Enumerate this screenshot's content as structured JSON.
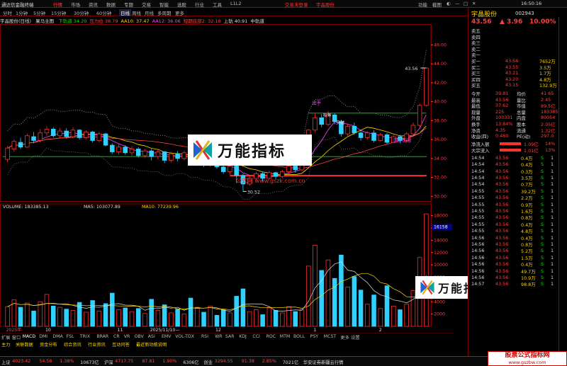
{
  "app": {
    "name": "通达信金融终端",
    "login_text": "交易未登录",
    "stock_tab": "宇晶股份",
    "win_controls": [
      "功能",
      "截图",
      "◐",
      "—",
      "□",
      "✕"
    ],
    "clock": "16:50:16"
  },
  "menu": [
    "行情",
    "市场",
    "资讯",
    "数据",
    "专题",
    "交易",
    "智能",
    "选股",
    "行业",
    "工具",
    "L1L2"
  ],
  "toolbar": [
    "分时",
    "1分钟",
    "5分钟",
    "15分钟",
    "30分钟",
    "60分钟",
    "日线",
    "周线",
    "月线",
    "多周期",
    "更多"
  ],
  "indicators": {
    "name": "宇晶股份(日线)",
    "mode": "果马主图",
    "items": [
      {
        "label": "下轨道",
        "value": "34.20",
        "color": "#00e000"
      },
      {
        "label": "压力位",
        "value": "38.79",
        "color": "#ff4040"
      },
      {
        "label": "AA10:",
        "value": "37.47",
        "color": "#ffd800"
      },
      {
        "label": "AA12:",
        "value": "36.06",
        "color": "#ff40ff"
      },
      {
        "label": "短期底部2:",
        "value": "32.18",
        "color": "#ff4040"
      },
      {
        "label": "上轨",
        "value": "40.91",
        "color": "#ddd"
      },
      {
        "label": "中轨道",
        "value": "",
        "color": "#ddd"
      }
    ]
  },
  "chart_data": {
    "type": "candlestick",
    "price_ticks": [
      "46.00",
      "44.00",
      "42.00",
      "40.00",
      "38.00",
      "36.00",
      "34.00",
      "32.00",
      "30.00"
    ],
    "price_range": [
      29.5,
      48.2
    ],
    "annotations": {
      "high": "43.56",
      "low": "30.52",
      "buy": "出手",
      "tag1": "吸筹",
      "tag2": "突破",
      "up": "回升加速"
    },
    "candles": [
      [
        33.9,
        35.1,
        33.6,
        35.3
      ],
      [
        35.0,
        35.8,
        34.7,
        36.0
      ],
      [
        35.7,
        35.2,
        35.0,
        36.2
      ],
      [
        35.2,
        36.4,
        35.1,
        36.6
      ],
      [
        36.3,
        35.9,
        35.6,
        36.8
      ],
      [
        35.9,
        36.7,
        35.7,
        37.1
      ],
      [
        36.7,
        37.1,
        36.4,
        37.4
      ],
      [
        37.1,
        36.4,
        36.2,
        37.3
      ],
      [
        36.4,
        36.9,
        36.1,
        37.2
      ],
      [
        36.9,
        36.3,
        36.1,
        37.2
      ],
      [
        36.3,
        37.0,
        36.1,
        37.3
      ],
      [
        37.0,
        36.2,
        36.0,
        37.1
      ],
      [
        36.2,
        36.8,
        36.0,
        37.0
      ],
      [
        36.8,
        35.9,
        35.7,
        36.9
      ],
      [
        35.9,
        36.6,
        35.7,
        36.8
      ],
      [
        36.6,
        35.4,
        35.3,
        36.7
      ],
      [
        35.4,
        34.7,
        34.5,
        35.6
      ],
      [
        34.7,
        35.2,
        34.4,
        35.5
      ],
      [
        35.2,
        34.6,
        34.4,
        35.4
      ],
      [
        34.6,
        35.0,
        34.3,
        35.3
      ],
      [
        35.0,
        34.3,
        34.1,
        35.2
      ],
      [
        34.3,
        34.8,
        34.1,
        35.0
      ],
      [
        34.8,
        34.2,
        33.8,
        35.0
      ],
      [
        34.2,
        34.7,
        33.9,
        34.9
      ],
      [
        34.7,
        33.8,
        33.5,
        34.8
      ],
      [
        33.8,
        34.5,
        33.6,
        34.7
      ],
      [
        34.5,
        34.0,
        33.7,
        34.8
      ],
      [
        34.0,
        34.6,
        33.8,
        34.8
      ],
      [
        34.6,
        33.6,
        33.4,
        34.8
      ],
      [
        33.6,
        34.2,
        33.4,
        34.4
      ],
      [
        34.2,
        33.3,
        33.1,
        34.4
      ],
      [
        33.3,
        33.8,
        33.1,
        34.1
      ],
      [
        33.8,
        33.1,
        32.9,
        34.0
      ],
      [
        33.1,
        32.6,
        32.4,
        33.3
      ],
      [
        32.6,
        33.2,
        32.3,
        33.4
      ],
      [
        33.2,
        32.2,
        31.4,
        33.4
      ],
      [
        32.2,
        31.3,
        30.5,
        32.4
      ],
      [
        31.3,
        31.9,
        31.1,
        32.1
      ],
      [
        31.9,
        32.4,
        31.7,
        32.6
      ],
      [
        32.4,
        31.9,
        31.6,
        32.6
      ],
      [
        31.9,
        32.5,
        31.7,
        32.7
      ],
      [
        32.5,
        32.1,
        31.8,
        32.6
      ],
      [
        32.1,
        32.6,
        31.9,
        32.8
      ],
      [
        32.6,
        33.2,
        32.4,
        33.4
      ],
      [
        33.2,
        32.8,
        32.5,
        33.4
      ],
      [
        32.8,
        33.6,
        32.6,
        33.8
      ],
      [
        33.6,
        37.0,
        33.5,
        37.1
      ],
      [
        37.0,
        38.3,
        36.8,
        38.8
      ],
      [
        38.3,
        37.6,
        37.3,
        38.7
      ],
      [
        37.6,
        38.6,
        37.4,
        39.0
      ],
      [
        38.6,
        37.9,
        37.6,
        38.8
      ],
      [
        37.9,
        36.6,
        36.3,
        38.1
      ],
      [
        36.6,
        37.4,
        36.4,
        37.6
      ],
      [
        37.4,
        36.7,
        36.5,
        37.8
      ],
      [
        36.7,
        36.2,
        35.9,
        37.0
      ],
      [
        36.2,
        36.7,
        36.0,
        36.9
      ],
      [
        36.7,
        35.9,
        35.7,
        37.0
      ],
      [
        35.9,
        36.5,
        35.8,
        36.7
      ],
      [
        36.5,
        35.7,
        35.5,
        36.7
      ],
      [
        35.7,
        36.3,
        35.6,
        36.5
      ],
      [
        36.3,
        35.9,
        35.6,
        36.5
      ],
      [
        35.9,
        36.6,
        35.7,
        36.8
      ],
      [
        36.6,
        37.5,
        36.4,
        37.8
      ],
      [
        37.5,
        39.6,
        37.3,
        39.8
      ],
      [
        39.6,
        43.56,
        39.5,
        43.56
      ]
    ],
    "volume_ticks": [
      "18000",
      "16000",
      "14000",
      "12000",
      "10000",
      "8000",
      "6000",
      "4000",
      "2000"
    ],
    "volume_range": [
      0,
      19000
    ],
    "volume_label": "VOLUME: 183385.13",
    "ma5_label": "MA5: 103077.89",
    "ma10_label": "MA10: 77239.96",
    "volume_marker": "16158",
    "volumes": [
      3200,
      4300,
      3100,
      3800,
      2500,
      4000,
      5200,
      3300,
      3100,
      2800,
      2600,
      3900,
      2300,
      4200,
      2500,
      3700,
      5400,
      2700,
      3000,
      2400,
      2900,
      2100,
      4400,
      2600,
      3500,
      2200,
      2800,
      2000,
      4600,
      3100,
      2300,
      3300,
      1800,
      2700,
      2200,
      4900,
      6100,
      2400,
      2700,
      1900,
      3000,
      2600,
      2200,
      3200,
      2400,
      2700,
      9800,
      13200,
      9100,
      10800,
      7800,
      11600,
      6400,
      8100,
      5900,
      3600,
      5100,
      2900,
      6600,
      3300,
      2700,
      3600,
      5800,
      11200,
      18300
    ],
    "x_labels": [
      {
        "text": "2025年",
        "i": 0
      },
      {
        "text": "10",
        "i": 6
      },
      {
        "text": "11",
        "i": 17
      },
      {
        "text": "2025/11/10—",
        "i": 22
      },
      {
        "text": "12",
        "i": 32
      },
      {
        "text": "1",
        "i": 47
      },
      {
        "text": "2",
        "i": 57
      }
    ]
  },
  "watermark": {
    "text": "万能指标",
    "url": "公式网 www.gszk.com.cn"
  },
  "tabs": [
    "扩展",
    "窗口",
    "MACD",
    "DMI",
    "DMA",
    "FSL",
    "TRIX",
    "BRAR",
    "CR",
    "VR",
    "OBV",
    "ASI",
    "EMV",
    "VOL-TDX",
    "RSI",
    "WR",
    "SAR",
    "KDJ",
    "CCI",
    "ROC",
    "MTM",
    "BOLL",
    "PSY",
    "MCST",
    "更多",
    "设置"
  ],
  "funcs": [
    "主力",
    "关联数据",
    "资金分布",
    "综合资讯",
    "行业资讯",
    "互动问答",
    "最近新功能说明"
  ],
  "quote": {
    "name": "宇晶股份",
    "code": "002943",
    "price": "43.56",
    "change": "3.96",
    "pct": "10.00%",
    "asks": [
      [
        "卖五",
        "",
        ""
      ],
      [
        "卖四",
        "",
        ""
      ],
      [
        "卖三",
        "",
        ""
      ],
      [
        "卖二",
        "",
        ""
      ],
      [
        "卖一",
        "",
        ""
      ]
    ],
    "bids": [
      [
        "买一",
        "43.56",
        "7652万"
      ],
      [
        "买二",
        "43.55",
        "3.5万"
      ],
      [
        "买三",
        "43.21",
        "1.7万"
      ],
      [
        "买四",
        "43.20",
        "4.8万"
      ],
      [
        "买五",
        "43.15",
        "132.9万"
      ]
    ],
    "stats": [
      [
        "今开",
        "39.81",
        "均价",
        "41.65"
      ],
      [
        "最高",
        "43.56",
        "量比",
        "2.45"
      ],
      [
        "最低",
        "37.62",
        "市值",
        "89.5亿"
      ],
      [
        "现量",
        "225",
        "总量",
        "183385"
      ],
      [
        "外盘",
        "103331",
        "内盘",
        "80054"
      ],
      [
        "换手",
        "13.84%",
        "股本",
        "2.05亿"
      ],
      [
        "净资",
        "4.35",
        "流通",
        "1.32亿"
      ],
      [
        "收益(四)",
        "0.480",
        "PE(动)",
        "297.0"
      ]
    ],
    "flows": [
      [
        "净流入额",
        "1.09亿",
        "14%"
      ],
      [
        "大宗流入",
        "1.01亿",
        "13%"
      ]
    ],
    "ticks": [
      [
        "14:54",
        "43.56",
        "0.4万",
        "S",
        "1"
      ],
      [
        "14:54",
        "43.56",
        "0.4万",
        "S",
        "1"
      ],
      [
        "14:54",
        "43.56",
        "0.3万",
        "S",
        "1"
      ],
      [
        "14:54",
        "43.56",
        "3.5万",
        "S",
        "1"
      ],
      [
        "14:54",
        "43.56",
        "0.7万",
        "S",
        "1"
      ],
      [
        "14:55",
        "43.56",
        "39.2万",
        "S",
        "1"
      ],
      [
        "14:55",
        "43.56",
        "2.2万",
        "S",
        "1"
      ],
      [
        "14:55",
        "43.56",
        "0.9万",
        "S",
        "1"
      ],
      [
        "14:55",
        "43.56",
        "1.6万",
        "S",
        "1"
      ],
      [
        "14:55",
        "43.56",
        "0.8万",
        "S",
        "1"
      ],
      [
        "14:55",
        "43.56",
        "0.4万",
        "S",
        "1"
      ],
      [
        "14:55",
        "43.56",
        "4.8万",
        "S",
        "1"
      ],
      [
        "14:56",
        "43.56",
        "0.4万",
        "S",
        "1"
      ],
      [
        "14:56",
        "43.56",
        "0.8万",
        "S",
        "1"
      ],
      [
        "14:56",
        "43.56",
        "5.2万",
        "S",
        "1"
      ],
      [
        "14:56",
        "43.56",
        "1.5万",
        "S",
        "1"
      ],
      [
        "14:56",
        "43.56",
        "0.4万",
        "S",
        "1"
      ],
      [
        "14:56",
        "43.56",
        "49.7万",
        "S",
        "1"
      ],
      [
        "14:56",
        "43.56",
        "10.9万",
        "S",
        "1"
      ],
      [
        "14:57",
        "43.56",
        "98.8万",
        "S",
        "1"
      ]
    ]
  },
  "status": [
    {
      "t": "上证",
      "c": "#ddd"
    },
    {
      "t": "4023.42",
      "c": "#ff4040"
    },
    {
      "t": "54.58",
      "c": "#ff4040"
    },
    {
      "t": "1.38%",
      "c": "#ff4040"
    },
    {
      "t": "10673亿",
      "c": "#ddd"
    },
    {
      "t": "沪深",
      "c": "#ddd"
    },
    {
      "t": "4717.75",
      "c": "#ff4040"
    },
    {
      "t": "87.81",
      "c": "#ff4040"
    },
    {
      "t": "1.90%",
      "c": "#ff4040"
    },
    {
      "t": "6306亿",
      "c": "#ddd"
    },
    {
      "t": "创业",
      "c": "#ddd"
    },
    {
      "t": "3294.55",
      "c": "#ff4040"
    },
    {
      "t": "91.38",
      "c": "#ff4040"
    },
    {
      "t": "2.85%",
      "c": "#ff4040"
    },
    {
      "t": "7021亿",
      "c": "#ddd"
    },
    {
      "t": "华安证券新疆云行情",
      "c": "#ddd"
    }
  ],
  "site_badge": {
    "title": "股票公式指标网",
    "url": "www.gszbw.com"
  }
}
